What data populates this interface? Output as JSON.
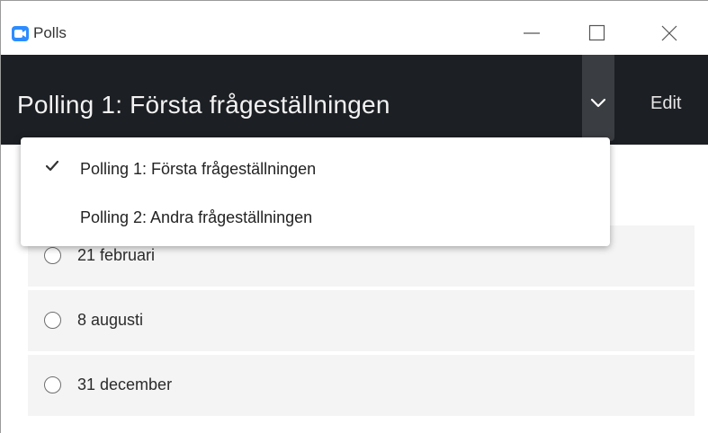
{
  "window": {
    "title": "Polls"
  },
  "header": {
    "poll_title": "Polling 1: Första frågeställningen",
    "edit_label": "Edit"
  },
  "dropdown": {
    "items": [
      {
        "label": "Polling 1: Första frågeställningen",
        "selected": true
      },
      {
        "label": "Polling 2: Andra frågeställningen",
        "selected": false
      }
    ]
  },
  "options": [
    {
      "label": "21 februari"
    },
    {
      "label": "8 augusti"
    },
    {
      "label": "31 december"
    }
  ],
  "colors": {
    "header_bg": "#1c1f23",
    "app_icon": "#2d8cff",
    "option_bg": "#f4f4f4"
  },
  "icons": {
    "app": "zoom-camera-icon",
    "chevron": "chevron-down-icon",
    "check": "checkmark-icon"
  }
}
